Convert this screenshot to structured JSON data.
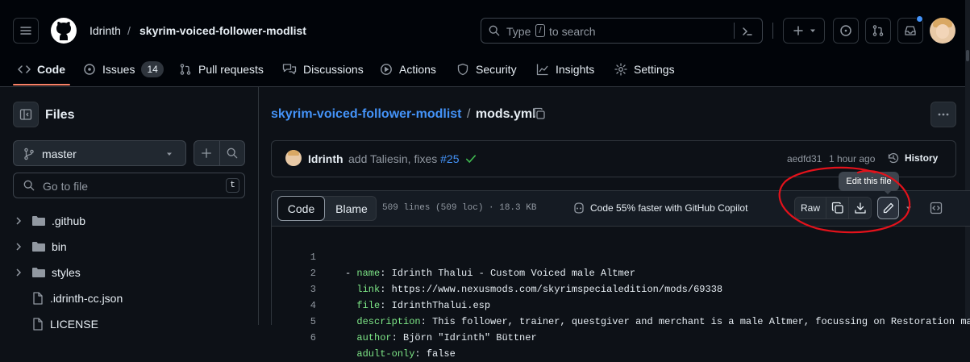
{
  "header": {
    "owner": "Idrinth",
    "separator": "/",
    "repo": "skyrim-voiced-follower-modlist",
    "search_placeholder_type": "Type",
    "search_slash": "/",
    "search_placeholder_rest": "to search"
  },
  "repo_nav": {
    "tabs": [
      {
        "label": "Code"
      },
      {
        "label": "Issues",
        "count": "14"
      },
      {
        "label": "Pull requests"
      },
      {
        "label": "Discussions"
      },
      {
        "label": "Actions"
      },
      {
        "label": "Security"
      },
      {
        "label": "Insights"
      },
      {
        "label": "Settings"
      }
    ]
  },
  "sidebar": {
    "title": "Files",
    "branch": "master",
    "goto_placeholder": "Go to file",
    "goto_shortcut": "t",
    "tree": [
      {
        "name": ".github",
        "type": "folder"
      },
      {
        "name": "bin",
        "type": "folder"
      },
      {
        "name": "styles",
        "type": "folder"
      },
      {
        "name": ".idrinth-cc.json",
        "type": "file"
      },
      {
        "name": "LICENSE",
        "type": "file"
      }
    ]
  },
  "breadcrumb": {
    "repo": "skyrim-voiced-follower-modlist",
    "sep": "/",
    "file": "mods.yml"
  },
  "commit": {
    "author": "Idrinth",
    "message": "add Taliesin, fixes",
    "issue": "#25",
    "sha": "aedfd31",
    "time": "1 hour ago",
    "history_label": "History"
  },
  "file_header": {
    "code_tab": "Code",
    "blame_tab": "Blame",
    "stats": "509 lines (509 loc) · 18.3 KB",
    "copilot": "Code 55% faster with GitHub Copilot",
    "raw": "Raw",
    "tooltip": "Edit this file"
  },
  "code": {
    "lines": [
      {
        "n": "1",
        "indent": "- ",
        "key": "name",
        "value": " Idrinth Thalui - Custom Voiced male Altmer"
      },
      {
        "n": "2",
        "indent": "  ",
        "key": "link",
        "value": " https://www.nexusmods.com/skyrimspecialedition/mods/69338"
      },
      {
        "n": "3",
        "indent": "  ",
        "key": "file",
        "value": " IdrinthThalui.esp"
      },
      {
        "n": "4",
        "indent": "  ",
        "key": "description",
        "value": " This follower, trainer, questgiver and merchant is a male Altmer, focussing on Restoration ma"
      },
      {
        "n": "5",
        "indent": "  ",
        "key": "author",
        "value": " Björn \"Idrinth\" Büttner"
      },
      {
        "n": "6",
        "indent": "  ",
        "key": "adult-only",
        "value": " false"
      }
    ]
  },
  "colors": {
    "background": "#0d1117",
    "header": "#010409",
    "accent_underline": "#f78166",
    "link": "#4493f8",
    "yaml_key": "#7ee787",
    "annotation": "#e3121b"
  }
}
